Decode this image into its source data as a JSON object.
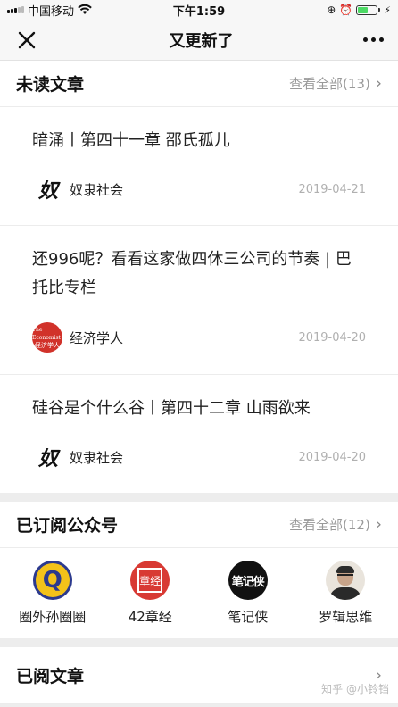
{
  "status_bar": {
    "carrier": "中国移动",
    "time": "下午1:59"
  },
  "nav": {
    "title": "又更新了",
    "close_icon": "close-icon",
    "more_icon": "more-icon"
  },
  "unread": {
    "title": "未读文章",
    "see_all": "查看全部(13)",
    "articles": [
      {
        "title": "暗涌丨第四十一章 邵氏孤儿",
        "source": "奴隶社会",
        "date": "2019-04-21"
      },
      {
        "title": "还996呢？看看这家做四休三公司的节奏 | 巴托比专栏",
        "source": "经济学人",
        "date": "2019-04-20"
      },
      {
        "title": "硅谷是个什么谷丨第四十二章 山雨欲来",
        "source": "奴隶社会",
        "date": "2019-04-20"
      }
    ]
  },
  "logos": {
    "nuli": "奴",
    "econ_en": "The Economist",
    "econ_cn": "经济学人"
  },
  "subscribed": {
    "title": "已订阅公众号",
    "see_all": "查看全部(12)",
    "accounts": [
      {
        "name": "圈外孙圈圈",
        "avatar_text": "Q"
      },
      {
        "name": "42章经",
        "avatar_text": "章经"
      },
      {
        "name": "笔记侠",
        "avatar_text": "笔记侠"
      },
      {
        "name": "罗辑思维",
        "avatar_text": ""
      }
    ]
  },
  "read": {
    "title": "已阅文章"
  },
  "watermark": "知乎 @小铃铛",
  "colors": {
    "background": "#ededed",
    "economist_red": "#d1322a",
    "battery_green": "#4cd964"
  }
}
